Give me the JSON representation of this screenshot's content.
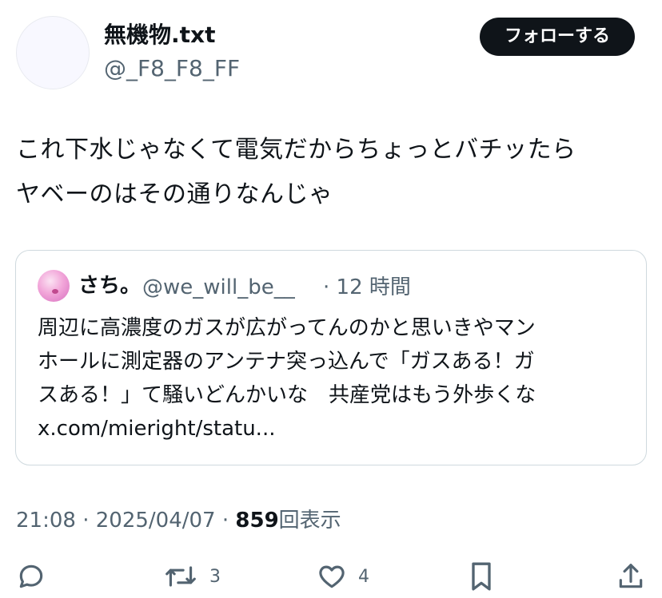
{
  "author": {
    "display_name": "無機物.txt",
    "handle": "@_F8_F8_FF"
  },
  "follow_button_label": "フォローする",
  "tweet": {
    "lines": [
      "これ下水じゃなくて電気だからちょっとバチッたら",
      "ヤベーのはその通りなんじゃ"
    ]
  },
  "quoted_tweet": {
    "display_name": "さち。",
    "handle": "@we_will_be__",
    "time": "· 12 時間",
    "lines": [
      "周辺に高濃度のガスが広がってんのかと思いきやマン",
      "ホールに測定器のアンテナ突っ込んで「ガスある！ガ",
      "スある！」て騒いどんかいな　共産党はもう外歩くな",
      "x.com/mieright/statu..."
    ]
  },
  "meta": {
    "time": "21:08",
    "date": "2025/04/07",
    "separator": "·",
    "views_count": "859",
    "views_label": "回表示"
  },
  "actions": {
    "reply_icon": "reply-icon",
    "retweet_icon": "retweet-icon",
    "retweet_count": "3",
    "like_icon": "like-icon",
    "like_count": "4",
    "bookmark_icon": "bookmark-icon",
    "share_icon": "share-icon"
  },
  "colors": {
    "text_primary": "#0f1419",
    "text_secondary": "#536471",
    "follow_button_bg": "#0f1419",
    "border": "#cfd9de"
  }
}
